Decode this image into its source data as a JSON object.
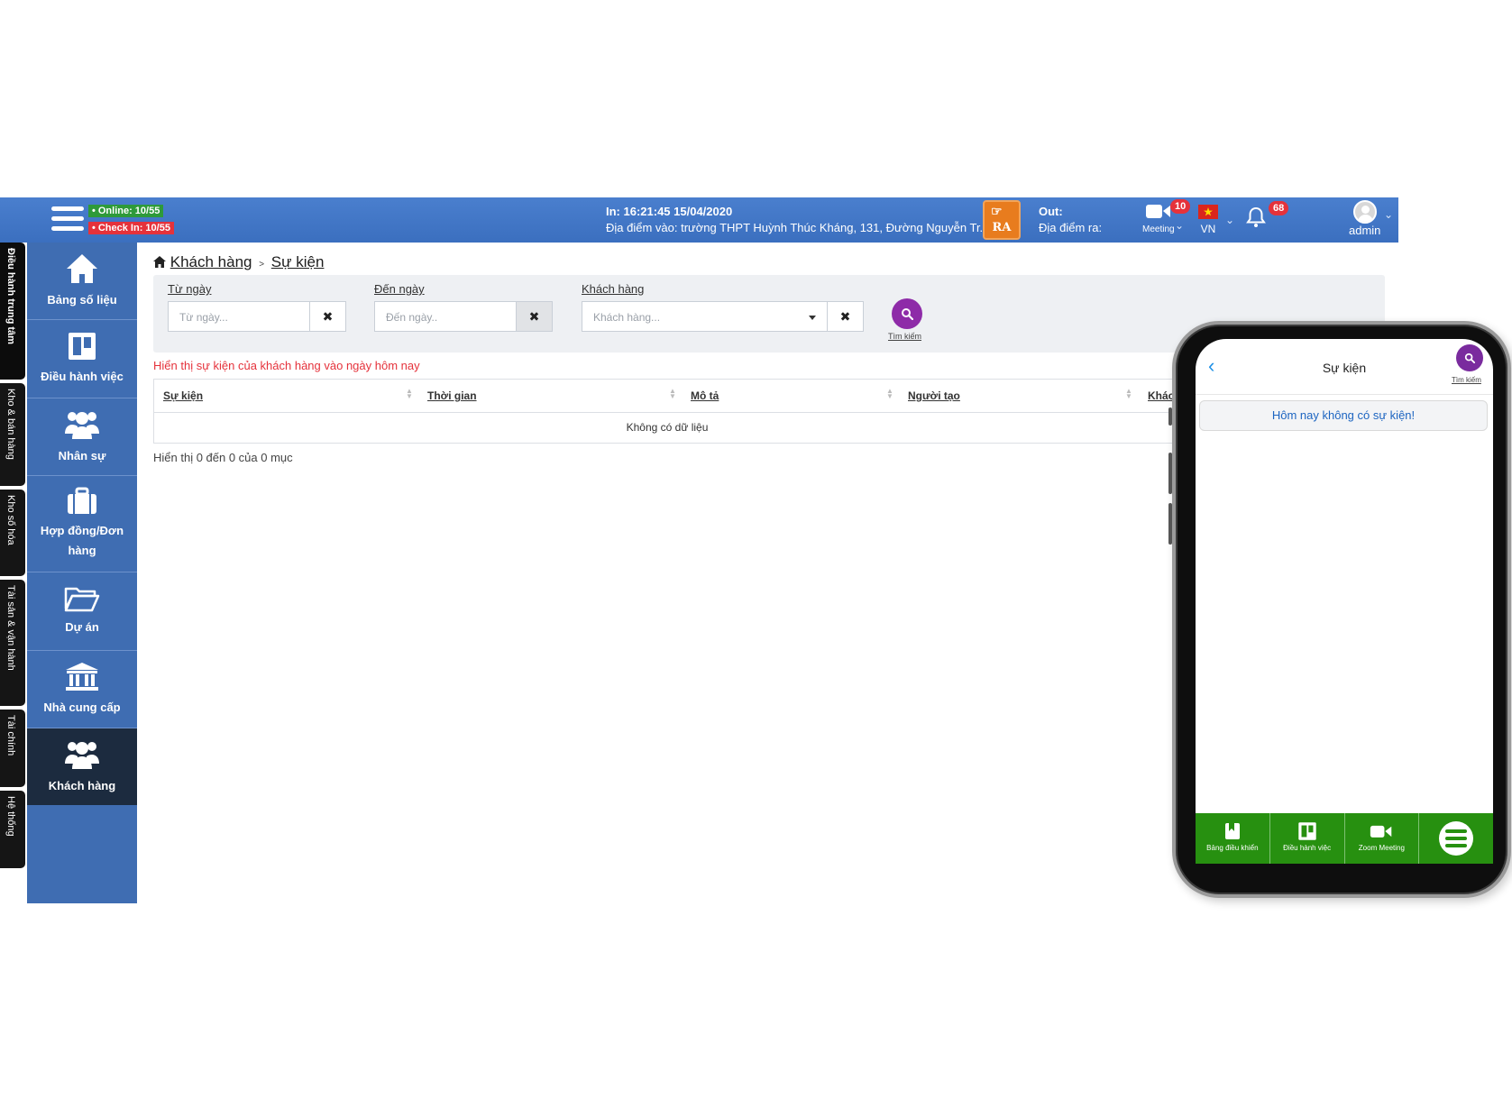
{
  "topbar": {
    "online": "Online: 10/55",
    "checkin": "Check In: 10/55",
    "in_line1": "In: 16:21:45 15/04/2020",
    "in_line2": "Địa điểm vào: trường THPT Huỳnh Thúc Kháng, 131, Đường Nguyễn Tr...",
    "ra_label": "RA",
    "out_line1": "Out:",
    "out_line2": "Địa điểm ra:",
    "meeting_label": "Meeting",
    "meeting_badge": "10",
    "lang_label": "VN",
    "notif_badge": "68",
    "user_label": "admin"
  },
  "vtabs": [
    "Điều hành trung tâm",
    "Kho & bán hàng",
    "Kho số hóa",
    "Tài sản & vận hành",
    "Tài chính",
    "Hệ thống"
  ],
  "sidebar": {
    "items": [
      {
        "label": "Bảng số liệu",
        "icon": "home-icon"
      },
      {
        "label": "Điều hành việc",
        "icon": "board-icon"
      },
      {
        "label": "Nhân sự",
        "icon": "users-icon"
      },
      {
        "label": "Hợp đồng/Đơn hàng",
        "icon": "briefcase-icon"
      },
      {
        "label": "Dự án",
        "icon": "folder-open-icon"
      },
      {
        "label": "Nhà cung cấp",
        "icon": "bank-icon"
      },
      {
        "label": "Khách hàng",
        "icon": "users-icon"
      }
    ]
  },
  "breadcrumb": {
    "parent": "Khách hàng",
    "separator": ">",
    "current": "Sự kiện"
  },
  "filters": {
    "from_label": "Từ ngày",
    "from_placeholder": "Từ ngày...",
    "to_label": "Đến ngày",
    "to_placeholder": "Đến ngày..",
    "customer_label": "Khách hàng",
    "customer_placeholder": "Khách hàng...",
    "clear_symbol": "✖",
    "search_caption": "Tìm kiếm"
  },
  "info_message": "Hiển thị sự kiện của khách hàng vào ngày hôm nay",
  "table": {
    "columns": [
      "Sự kiện",
      "Thời gian",
      "Mô tả",
      "Người tạo",
      "Khác"
    ],
    "empty_text": "Không có dữ liệu"
  },
  "footer_info": "Hiển thị 0 đến 0 của 0 mục",
  "phone": {
    "title": "Sự kiện",
    "search_caption": "Tìm kiếm",
    "message": "Hôm nay không có sự kiện!",
    "tabs": [
      {
        "label": "Bảng điều khiển",
        "icon": "book-icon"
      },
      {
        "label": "Điều hành việc",
        "icon": "board-icon"
      },
      {
        "label": "Zoom Meeting",
        "icon": "video-icon"
      }
    ]
  },
  "colors": {
    "topbar": "#4a7fce",
    "sidebar": "#3f6db2",
    "sidebar_active": "#1c2b3f",
    "search_button": "#8e2ba8",
    "phone_bottom_bar": "#279010",
    "info_red": "#e5323b"
  }
}
